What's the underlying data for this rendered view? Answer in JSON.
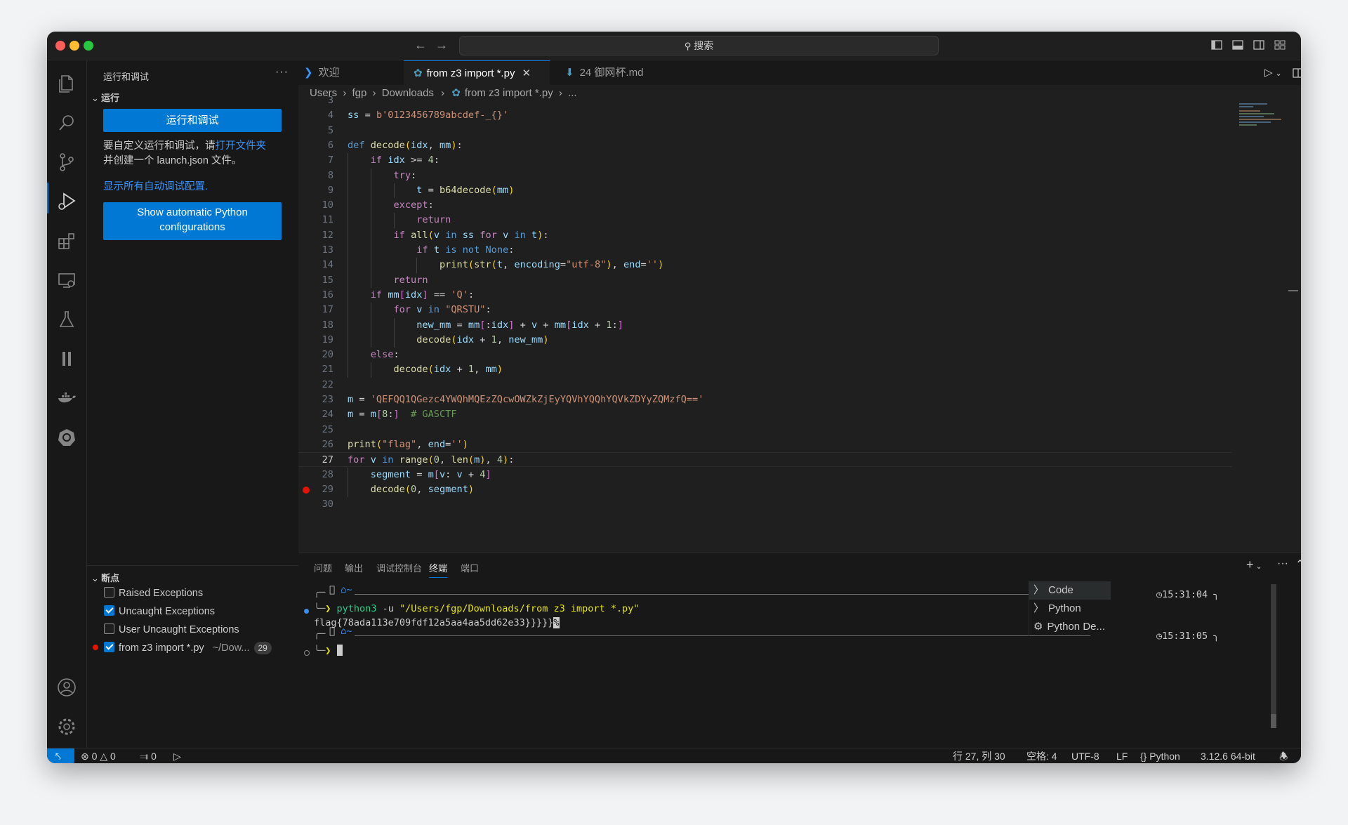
{
  "titlebar": {
    "search_placeholder": "搜索"
  },
  "sidebar": {
    "title": "运行和调试",
    "run_section": "运行",
    "run_button": "运行和调试",
    "info_text_before": "要自定义运行和调试，请",
    "info_link": "打开文件夹",
    "info_text_after": "并创建一个 launch.json 文件。",
    "show_all_link": "显示所有自动调试配置.",
    "python_button_line1": "Show automatic Python",
    "python_button_line2": "configurations",
    "breakpoints_section": "断点",
    "breakpoints": [
      {
        "label": "Raised Exceptions",
        "checked": false
      },
      {
        "label": "Uncaught Exceptions",
        "checked": true
      },
      {
        "label": "User Uncaught Exceptions",
        "checked": false
      },
      {
        "label": "from z3 import *.py",
        "checked": true,
        "path": "~/Dow...",
        "line": "29"
      }
    ]
  },
  "tabs": [
    {
      "label": "欢迎",
      "active": false
    },
    {
      "label": "from z3 import *.py",
      "active": true
    },
    {
      "label": "24 御网杯.md",
      "active": false
    }
  ],
  "breadcrumb": [
    "Users",
    "fgp",
    "Downloads",
    "from z3 import *.py",
    "..."
  ],
  "editor": {
    "current_line": 27,
    "breakpoint_line": 29,
    "lines": [
      {
        "n": "3",
        "code": ""
      },
      {
        "n": "4",
        "code": "ss = b'0123456789abcdef-_{}'"
      },
      {
        "n": "5",
        "code": ""
      },
      {
        "n": "6",
        "code": "def decode(idx, mm):"
      },
      {
        "n": "7",
        "code": "    if idx >= 4:"
      },
      {
        "n": "8",
        "code": "        try:"
      },
      {
        "n": "9",
        "code": "            t = b64decode(mm)"
      },
      {
        "n": "10",
        "code": "        except:"
      },
      {
        "n": "11",
        "code": "            return"
      },
      {
        "n": "12",
        "code": "        if all(v in ss for v in t):"
      },
      {
        "n": "13",
        "code": "            if t is not None:"
      },
      {
        "n": "14",
        "code": "                print(str(t, encoding=\"utf-8\"), end='')"
      },
      {
        "n": "15",
        "code": "        return"
      },
      {
        "n": "16",
        "code": "    if mm[idx] == 'Q':"
      },
      {
        "n": "17",
        "code": "        for v in \"QRSTU\":"
      },
      {
        "n": "18",
        "code": "            new_mm = mm[:idx] + v + mm[idx + 1:]"
      },
      {
        "n": "19",
        "code": "            decode(idx + 1, new_mm)"
      },
      {
        "n": "20",
        "code": "    else:"
      },
      {
        "n": "21",
        "code": "        decode(idx + 1, mm)"
      },
      {
        "n": "22",
        "code": ""
      },
      {
        "n": "23",
        "code": "m = 'QEFQQ1QGezc4YWQhMQEzZQcwOWZkZjEyYQVhYQQhYQVkZDYyZQMzfQ=='"
      },
      {
        "n": "24",
        "code": "m = m[8:]  # GASCTF"
      },
      {
        "n": "25",
        "code": ""
      },
      {
        "n": "26",
        "code": "print(\"flag\", end='')"
      },
      {
        "n": "27",
        "code": "for v in range(0, len(m), 4):"
      },
      {
        "n": "28",
        "code": "    segment = m[v: v + 4]"
      },
      {
        "n": "29",
        "code": "    decode(0, segment)"
      },
      {
        "n": "30",
        "code": ""
      }
    ]
  },
  "panel": {
    "tabs": [
      "问题",
      "输出",
      "调试控制台",
      "终端",
      "端口"
    ],
    "active_tab": "终端",
    "prompt_dir": "~",
    "time1": "15:31:04",
    "time2": "15:31:05",
    "command_bin": "python3",
    "command_flag": "-u",
    "command_arg": "\"/Users/fgp/Downloads/from z3 import *.py\"",
    "output": "flag{78ada113e709fdf12a5aa4aa5dd62e33}}}}}",
    "terminals": [
      "Code",
      "Python",
      "Python De..."
    ]
  },
  "statusbar": {
    "errors": "0",
    "warnings": "0",
    "ports": "0",
    "position": "行 27, 列 30",
    "spaces": "空格: 4",
    "encoding": "UTF-8",
    "eol": "LF",
    "language": "Python",
    "interpreter": "3.12.6 64-bit"
  }
}
